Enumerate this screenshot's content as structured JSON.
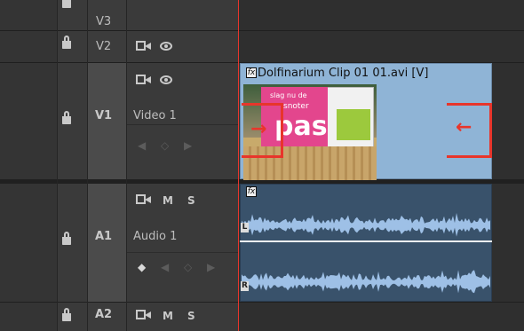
{
  "tracks": {
    "v3": {
      "name": "V3"
    },
    "v2": {
      "name": "V2"
    },
    "v1": {
      "name": "V1",
      "label": "Video 1"
    },
    "a1": {
      "name": "A1",
      "label": "Audio 1",
      "mute": "M",
      "solo": "S"
    },
    "a2": {
      "name": "A2",
      "mute": "M",
      "solo": "S"
    }
  },
  "clips": {
    "video": {
      "title": "Dolfinarium Clip 01 01.avi [V]",
      "fx": "fx"
    },
    "audio": {
      "fx": "fx",
      "left": "L",
      "right": "R"
    }
  },
  "thumbnail": {
    "headline": "pas",
    "tagline": "slag nu de",
    "subline": "snoter"
  },
  "colors": {
    "playhead": "#e8352b",
    "video_clip": "#8fb4d6",
    "audio_clip": "#39526b",
    "waveform": "#9ec0e6"
  }
}
